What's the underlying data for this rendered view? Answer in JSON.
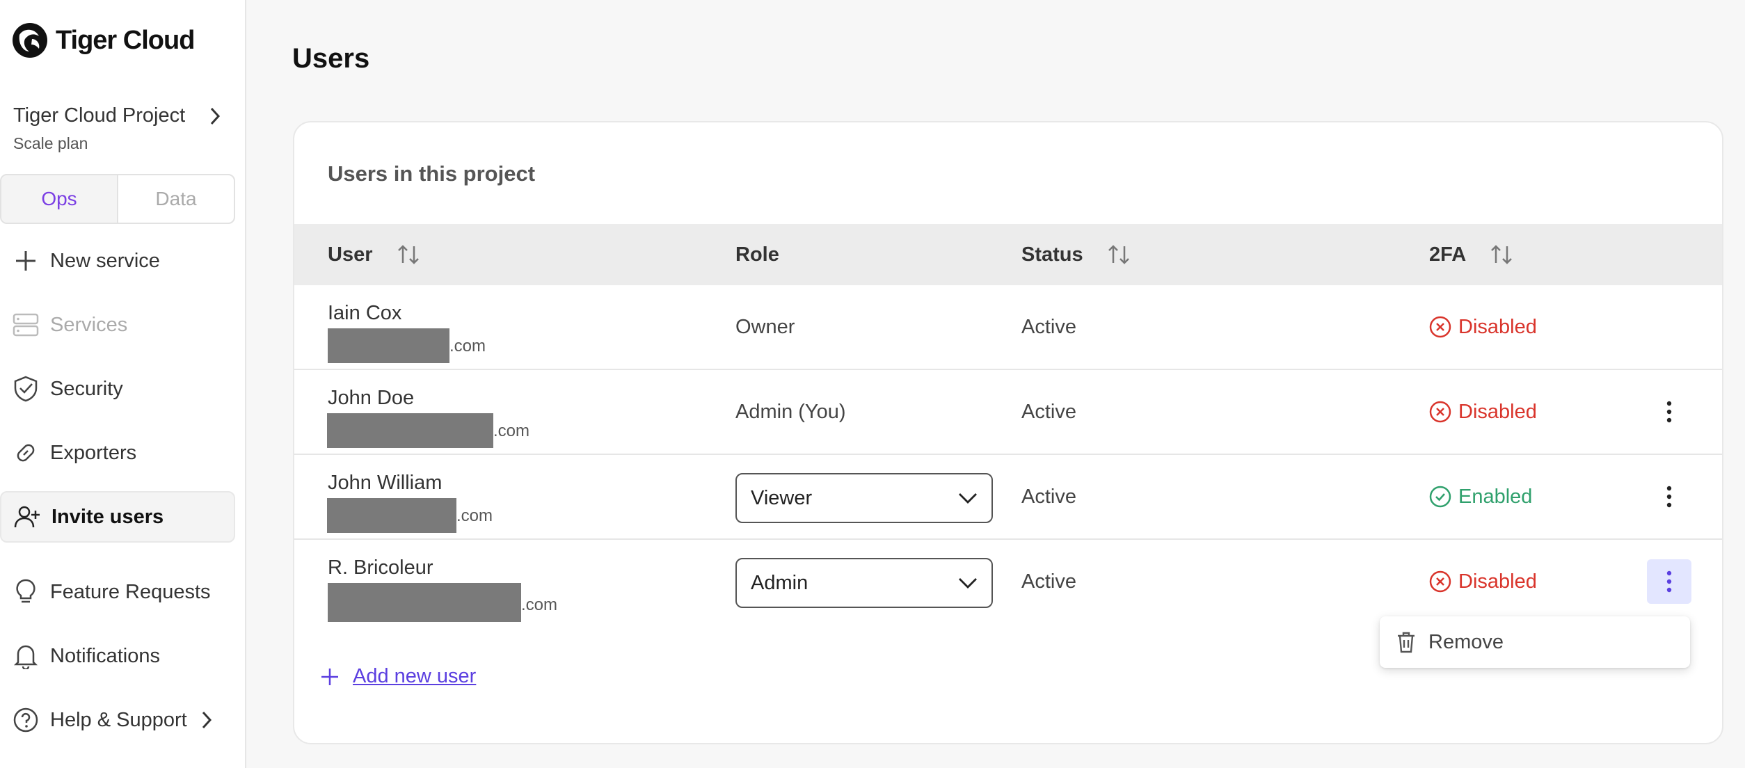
{
  "app": {
    "name": "Tiger Cloud"
  },
  "project": {
    "name": "Tiger Cloud Project",
    "plan": "Scale plan"
  },
  "mode_toggle": {
    "options": [
      "Ops",
      "Data"
    ],
    "selected": "Ops"
  },
  "sidebar": {
    "items": [
      {
        "label": "New service",
        "icon": "plus-icon"
      },
      {
        "label": "Services",
        "icon": "server-icon",
        "disabled": true
      },
      {
        "label": "Security",
        "icon": "shield-check-icon"
      },
      {
        "label": "Exporters",
        "icon": "link-icon"
      },
      {
        "label": "Invite users",
        "icon": "user-plus-icon",
        "selected": true
      },
      {
        "label": "Feature Requests",
        "icon": "lightbulb-icon"
      },
      {
        "label": "Notifications",
        "icon": "bell-icon"
      },
      {
        "label": "Help & Support",
        "icon": "help-circle-icon"
      }
    ]
  },
  "page": {
    "title": "Users"
  },
  "card": {
    "title": "Users in this project"
  },
  "table": {
    "columns": [
      "User",
      "Role",
      "Status",
      "2FA"
    ],
    "rows": [
      {
        "name": "Iain Cox",
        "email_suffix": ".com",
        "role": "Owner",
        "status": "Active",
        "twofa": "Disabled"
      },
      {
        "name": "John Doe",
        "email_suffix": ".com",
        "role": "Admin (You)",
        "status": "Active",
        "twofa": "Disabled"
      },
      {
        "name": "John William",
        "email_suffix": ".com",
        "role": "Viewer",
        "status": "Active",
        "twofa": "Enabled"
      },
      {
        "name": "R. Bricoleur",
        "email_suffix": ".com",
        "role": "Admin",
        "status": "Active",
        "twofa": "Disabled"
      }
    ]
  },
  "context_menu": {
    "remove_label": "Remove"
  },
  "actions": {
    "add_user_label": "Add new user"
  },
  "colors": {
    "accent": "#7b3fe4",
    "link": "#5b3fe0",
    "danger": "#d9342b",
    "success": "#2fa06c"
  }
}
